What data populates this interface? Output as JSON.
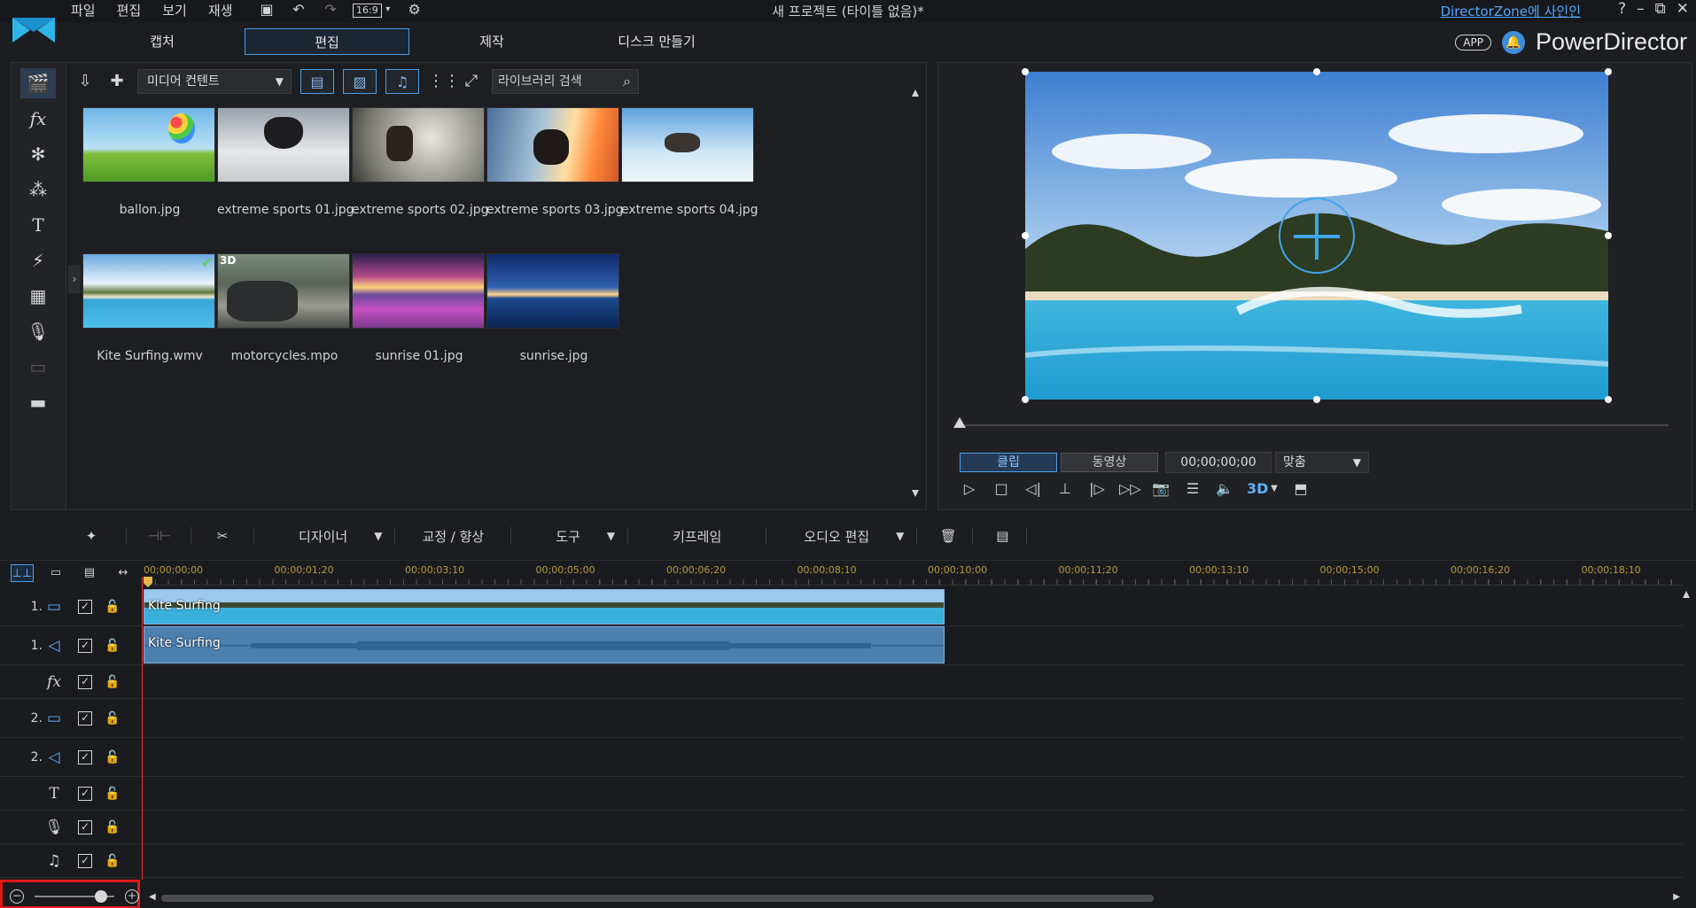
{
  "menu": [
    "파일",
    "편집",
    "보기",
    "재생"
  ],
  "quick": {
    "aspect": "16:9"
  },
  "window_title": "새 프로젝트 (타이틀 없음)*",
  "signin": "DirectorZone에 사인인",
  "window_controls": [
    "?",
    "–",
    "⧉",
    "✕"
  ],
  "tabs": [
    "캡처",
    "편집",
    "제작",
    "디스크 만들기"
  ],
  "brand": {
    "app": "APP",
    "name": "PowerDirector"
  },
  "library": {
    "dropdown": "미디어 컨텐트",
    "search_placeholder": "라이브러리 검색",
    "items": [
      {
        "name": "ballon.jpg"
      },
      {
        "name": "extreme sports 01.jpg"
      },
      {
        "name": "extreme sports 02.jpg"
      },
      {
        "name": "extreme sports 03.jpg"
      },
      {
        "name": "extreme sports 04.jpg"
      },
      {
        "name": "Kite Surfing.wmv"
      },
      {
        "name": "motorcycles.mpo",
        "badge": "3D"
      },
      {
        "name": "sunrise 01.jpg"
      },
      {
        "name": "sunrise.jpg"
      }
    ]
  },
  "preview": {
    "seg_clip": "클립",
    "seg_movie": "동영상",
    "timecode": "00;00;00;00",
    "fit": "맞춤",
    "threed": "3D"
  },
  "edit_toolbar": {
    "designer": "디자이너",
    "fix": "교정 / 향상",
    "tools": "도구",
    "keyframe": "키프레임",
    "audio_edit": "오디오 편집"
  },
  "timeline": {
    "ticks": [
      "00;00;00;00",
      "00;00;01;20",
      "00;00;03;10",
      "00;00;05;00",
      "00;00;06;20",
      "00;00;08;10",
      "00;00;10;00",
      "00;00;11;20",
      "00;00;13;10",
      "00;00;15;00",
      "00;00;16;20",
      "00;00;18;10"
    ],
    "tracks": [
      {
        "num": "1.",
        "type": "video",
        "clip": "Kite Surfing"
      },
      {
        "num": "1.",
        "type": "audio",
        "clip": "Kite Surfing"
      },
      {
        "num": "",
        "type": "fx"
      },
      {
        "num": "2.",
        "type": "video"
      },
      {
        "num": "2.",
        "type": "audio"
      },
      {
        "num": "",
        "type": "title"
      },
      {
        "num": "",
        "type": "voice"
      },
      {
        "num": "",
        "type": "music"
      }
    ]
  },
  "colors": {
    "accent": "#4b9fe8",
    "playhead": "#e33333",
    "highlight": "#e01818"
  }
}
